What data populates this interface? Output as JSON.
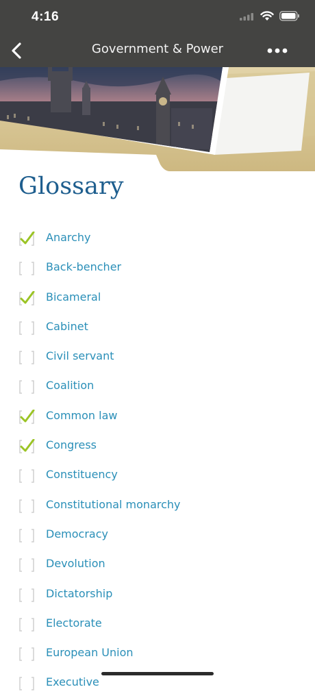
{
  "status_bar": {
    "time": "4:16"
  },
  "nav": {
    "title": "Government & Power"
  },
  "page": {
    "title": "Glossary"
  },
  "colors": {
    "header": "#444442",
    "title": "#1e5e8e",
    "term": "#2a8fb8",
    "check": "#9bc425"
  },
  "glossary": [
    {
      "term": "Anarchy",
      "checked": true
    },
    {
      "term": "Back-bencher",
      "checked": false
    },
    {
      "term": "Bicameral",
      "checked": true
    },
    {
      "term": "Cabinet",
      "checked": false
    },
    {
      "term": "Civil servant",
      "checked": false
    },
    {
      "term": "Coalition",
      "checked": false
    },
    {
      "term": "Common law",
      "checked": true
    },
    {
      "term": "Congress",
      "checked": true
    },
    {
      "term": "Constituency",
      "checked": false
    },
    {
      "term": "Constitutional monarchy",
      "checked": false
    },
    {
      "term": "Democracy",
      "checked": false
    },
    {
      "term": "Devolution",
      "checked": false
    },
    {
      "term": "Dictatorship",
      "checked": false
    },
    {
      "term": "Electorate",
      "checked": false
    },
    {
      "term": "European Union",
      "checked": false
    },
    {
      "term": "Executive",
      "checked": false
    }
  ]
}
